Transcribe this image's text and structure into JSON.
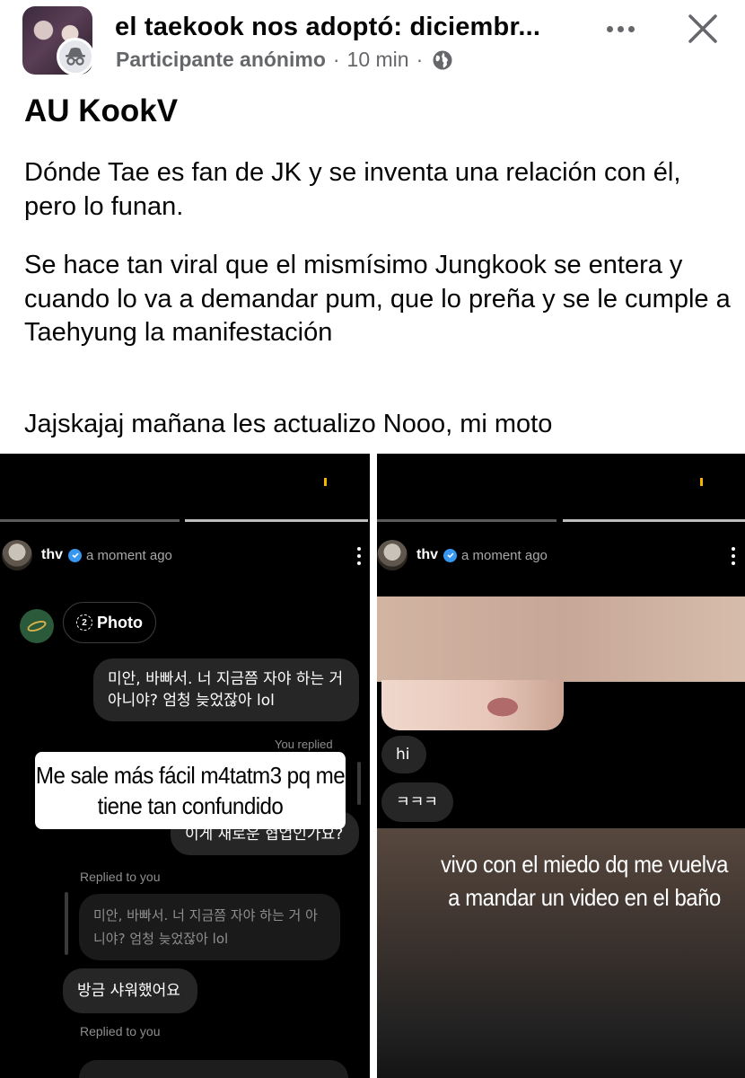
{
  "header": {
    "group_name": "el taekook nos adoptó: diciembr...",
    "author": "Participante anónimo",
    "time": "10 min",
    "separator": "·",
    "icons": {
      "anon": "incognito-icon",
      "privacy": "globe-icon",
      "more": "more-dots-icon",
      "close": "close-icon"
    }
  },
  "post": {
    "title": "AU KookV",
    "paragraph_1": "Dónde Tae es fan de JK y se inventa una relación con él, pero lo funan.",
    "paragraph_2": "Se hace tan viral que el mismísimo Jungkook se entera y cuando lo va a demandar pum, que lo preña y se le cumple a Taehyung la manifestación",
    "paragraph_3": "Jajskajaj mañana les actualizo Nooo, mi moto"
  },
  "screenshot_left": {
    "username": "thv",
    "time": "a moment ago",
    "photo_label": "Photo",
    "photo_count": "2",
    "msg_1": "미안, 바빠서. 너 지금쯤 자야 하는 거 아니야? 엄청 늦었잖아 lol",
    "you_replied": "You replied",
    "overlay": "Me sale más fácil m4tatm3 pq me tiene tan confundido",
    "msg_2": "이게 새로운 협업인가요?",
    "replied_to_you_1": "Replied to you",
    "quoted": "미안, 바빠서. 너 지금쯤 자야 하는 거 아니야? 엄청 늦었잖아 lol",
    "msg_3": "방금 샤워했어요",
    "replied_to_you_2": "Replied to you"
  },
  "screenshot_right": {
    "username": "thv",
    "time": "a moment ago",
    "msg_hi": "hi",
    "msg_laugh": "ㅋㅋㅋ",
    "overlay": "vivo con el miedo dq me vuelva a mandar un video en el baño"
  },
  "colors": {
    "text": "#050505",
    "secondary": "#65676b",
    "verified": "#3797f0",
    "bubble": "#262626",
    "story_bg": "#000000"
  }
}
